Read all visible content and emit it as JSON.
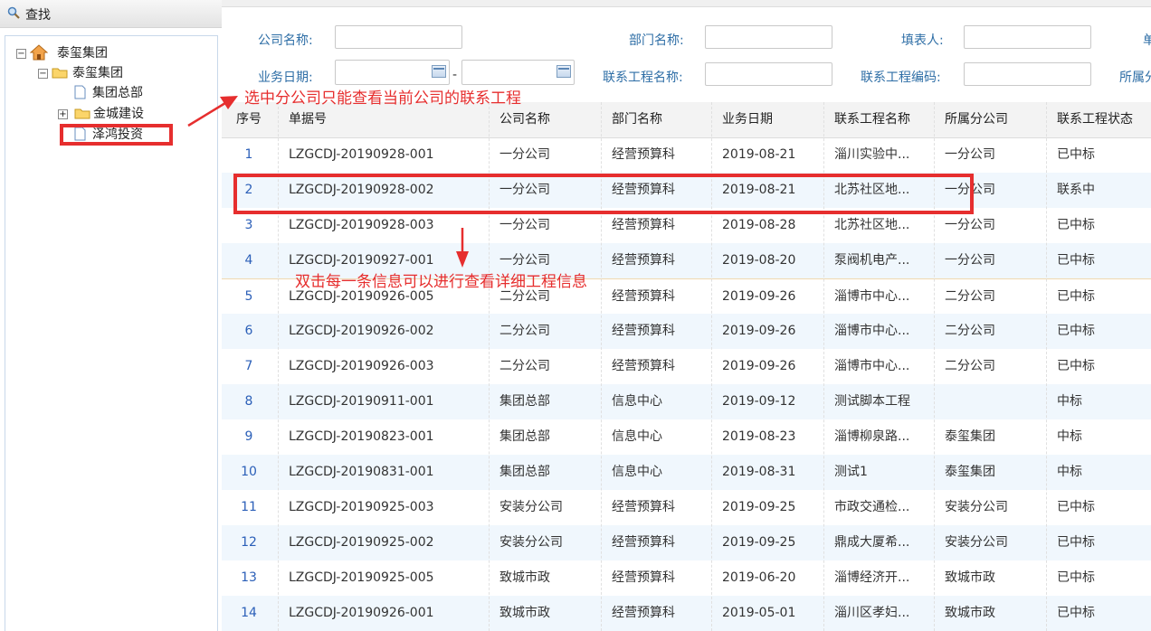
{
  "left_panel": {
    "title": "查找",
    "tree": {
      "root": "泰玺集团",
      "child": "泰玺集团",
      "items": [
        "集团总部",
        "金城建设",
        "泽鸿投资"
      ]
    }
  },
  "filters": {
    "company_label": "公司名称:",
    "dept_label": "部门名称:",
    "filler_label": "填表人:",
    "cut_label_1": "单",
    "date_label": "业务日期:",
    "date_sep": "-",
    "project_name_label": "联系工程名称:",
    "project_code_label": "联系工程编码:",
    "cut_label_2": "所属分"
  },
  "table": {
    "headers": [
      "序号",
      "单据号",
      "公司名称",
      "部门名称",
      "业务日期",
      "联系工程名称",
      "所属分公司",
      "联系工程状态"
    ],
    "rows": [
      [
        "1",
        "LZGCDJ-20190928-001",
        "一分公司",
        "经营预算科",
        "2019-08-21",
        "淄川实验中...",
        "一分公司",
        "已中标"
      ],
      [
        "2",
        "LZGCDJ-20190928-002",
        "一分公司",
        "经营预算科",
        "2019-08-21",
        "北苏社区地...",
        "一分公司",
        "联系中"
      ],
      [
        "3",
        "LZGCDJ-20190928-003",
        "一分公司",
        "经营预算科",
        "2019-08-28",
        "北苏社区地...",
        "一分公司",
        "已中标"
      ],
      [
        "4",
        "LZGCDJ-20190927-001",
        "一分公司",
        "经营预算科",
        "2019-08-20",
        "泵阀机电产...",
        "一分公司",
        "已中标"
      ],
      [
        "5",
        "LZGCDJ-20190926-005",
        "二分公司",
        "经营预算科",
        "2019-09-26",
        "淄博市中心...",
        "二分公司",
        "已中标"
      ],
      [
        "6",
        "LZGCDJ-20190926-002",
        "二分公司",
        "经营预算科",
        "2019-09-26",
        "淄博市中心...",
        "二分公司",
        "已中标"
      ],
      [
        "7",
        "LZGCDJ-20190926-003",
        "二分公司",
        "经营预算科",
        "2019-09-26",
        "淄博市中心...",
        "二分公司",
        "已中标"
      ],
      [
        "8",
        "LZGCDJ-20190911-001",
        "集团总部",
        "信息中心",
        "2019-09-12",
        "测试脚本工程",
        "",
        "中标"
      ],
      [
        "9",
        "LZGCDJ-20190823-001",
        "集团总部",
        "信息中心",
        "2019-08-23",
        "淄博柳泉路...",
        "泰玺集团",
        "中标"
      ],
      [
        "10",
        "LZGCDJ-20190831-001",
        "集团总部",
        "信息中心",
        "2019-08-31",
        "测试1",
        "泰玺集团",
        "中标"
      ],
      [
        "11",
        "LZGCDJ-20190925-003",
        "安装分公司",
        "经营预算科",
        "2019-09-25",
        "市政交通检...",
        "安装分公司",
        "已中标"
      ],
      [
        "12",
        "LZGCDJ-20190925-002",
        "安装分公司",
        "经营预算科",
        "2019-09-25",
        "鼎成大厦希...",
        "安装分公司",
        "已中标"
      ],
      [
        "13",
        "LZGCDJ-20190925-005",
        "致城市政",
        "经营预算科",
        "2019-06-20",
        "淄博经济开...",
        "致城市政",
        "已中标"
      ],
      [
        "14",
        "LZGCDJ-20190926-001",
        "致城市政",
        "经营预算科",
        "2019-05-01",
        "淄川区孝妇...",
        "致城市政",
        "已中标"
      ]
    ]
  },
  "annotations": {
    "note1": "选中分公司只能查看当前公司的联系工程",
    "note2": "双击每一条信息可以进行查看详细工程信息"
  },
  "colors": {
    "label_blue": "#2e6ea6",
    "seq_blue": "#2b5fb8",
    "annotation_red": "#e62e2e",
    "alt_row": "#f0f7fd"
  }
}
